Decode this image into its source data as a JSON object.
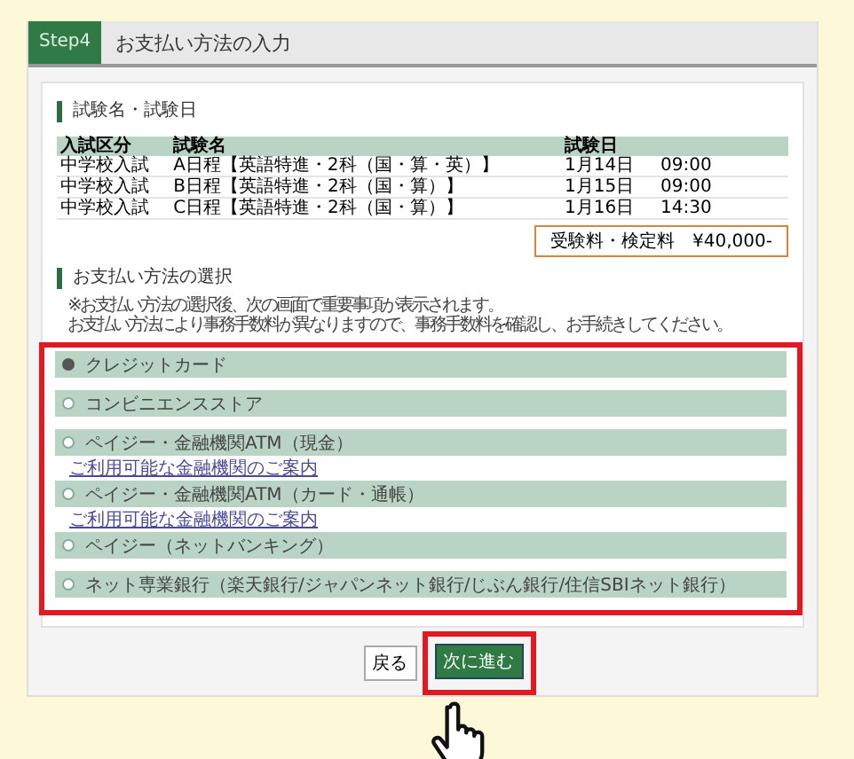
{
  "header": {
    "step": "Step4",
    "title": "お支払い方法の入力"
  },
  "exam_section": {
    "title": "試験名・試験日",
    "columns": [
      "入試区分",
      "試験名",
      "試験日"
    ],
    "rows": [
      [
        "中学校入試",
        "A日程【英語特進・2科（国・算・英）】",
        "1月14日",
        "09:00"
      ],
      [
        "中学校入試",
        "B日程【英語特進・2科（国・算）】",
        "1月15日",
        "09:00"
      ],
      [
        "中学校入試",
        "C日程【英語特進・2科（国・算）】",
        "1月16日",
        "14:30"
      ]
    ],
    "fee": "受験料・検定料　¥40,000-"
  },
  "payment_section": {
    "title": "お支払い方法の選択",
    "notes": [
      "※お支払い方法の選択後、次の画面で重要事項が表示されます。",
      "お支払い方法により事務手数料が異なりますので、事務手数料を確認し、お手続きしてください。"
    ],
    "options": [
      {
        "label": "クレジットカード",
        "selected": true
      },
      {
        "label": "コンビニエンスストア",
        "selected": false
      },
      {
        "label": "ペイジー・金融機関ATM（現金）",
        "selected": false,
        "link": "ご利用可能な金融機関のご案内"
      },
      {
        "label": "ペイジー・金融機関ATM（カード・通帳）",
        "selected": false,
        "link": "ご利用可能な金融機関のご案内"
      },
      {
        "label": "ペイジー（ネットバンキング）",
        "selected": false
      },
      {
        "label": "ネット専業銀行（楽天銀行/ジャパンネット銀行/じぶん銀行/住信SBIネット銀行）",
        "selected": false
      }
    ]
  },
  "buttons": [
    {
      "label": "戻る",
      "kind": "back"
    },
    {
      "label": "次に進む",
      "kind": "next"
    }
  ]
}
